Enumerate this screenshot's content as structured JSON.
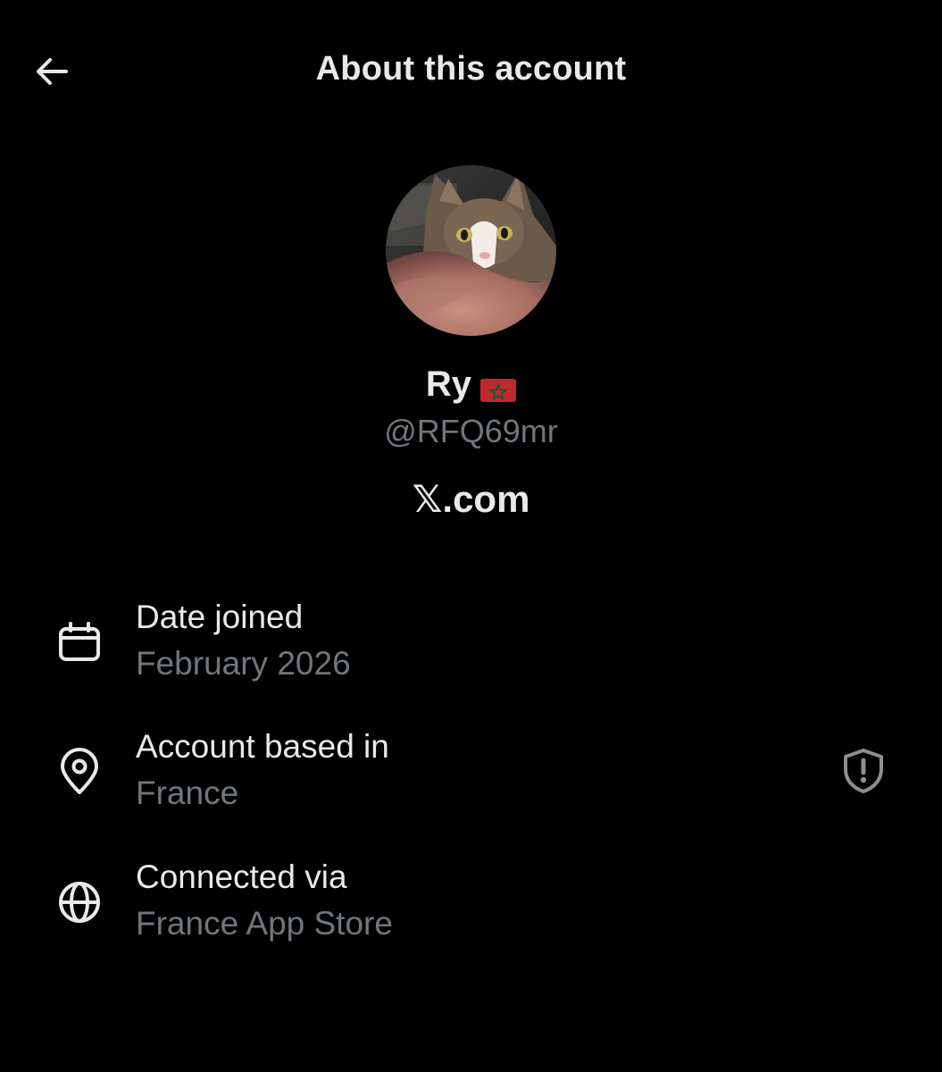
{
  "header": {
    "title": "About this account",
    "back_icon": "arrow-left-icon"
  },
  "profile": {
    "display_name": "Ry",
    "flag_icon": "morocco-flag-icon",
    "handle": "@RFQ69mr",
    "brand": "𝕏.com"
  },
  "details": [
    {
      "icon": "calendar-icon",
      "label": "Date joined",
      "value": "February 2026"
    },
    {
      "icon": "location-pin-icon",
      "label": "Account based in",
      "value": "France",
      "badge_icon": "shield-alert-icon"
    },
    {
      "icon": "globe-icon",
      "label": "Connected via",
      "value": "France App Store"
    }
  ],
  "colors": {
    "background": "#000000",
    "primary_text": "#e7e9ea",
    "secondary_text": "#71767b"
  }
}
